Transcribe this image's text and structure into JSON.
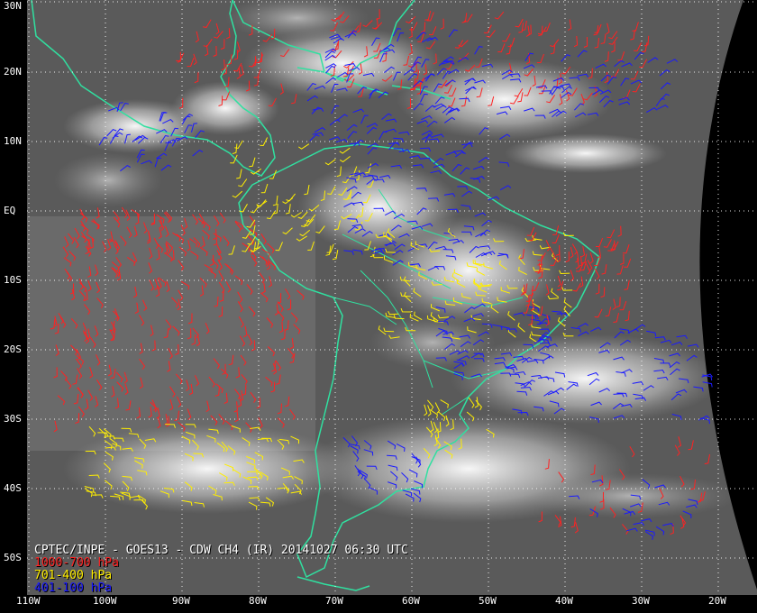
{
  "title": "CPTEC/INPE - GOES13 - CDW CH4 (IR) 20141027 06:30 UTC",
  "legend": [
    {
      "label": "1000-700 hPa",
      "color": "#ff2222"
    },
    {
      "label": "701-400 hPa",
      "color": "#ffee00"
    },
    {
      "label": "401-100 hPa",
      "color": "#1a1aff"
    }
  ],
  "lat_labels": [
    "30N",
    "20N",
    "10N",
    "EQ",
    "10S",
    "20S",
    "30S",
    "40S",
    "50S"
  ],
  "lon_labels": [
    "110W",
    "100W",
    "90W",
    "80W",
    "70W",
    "60W",
    "50W",
    "40W",
    "30W",
    "20W"
  ],
  "colors": {
    "coastline": "#30e0a0",
    "grid": "#ffffff",
    "space": "#000000"
  }
}
